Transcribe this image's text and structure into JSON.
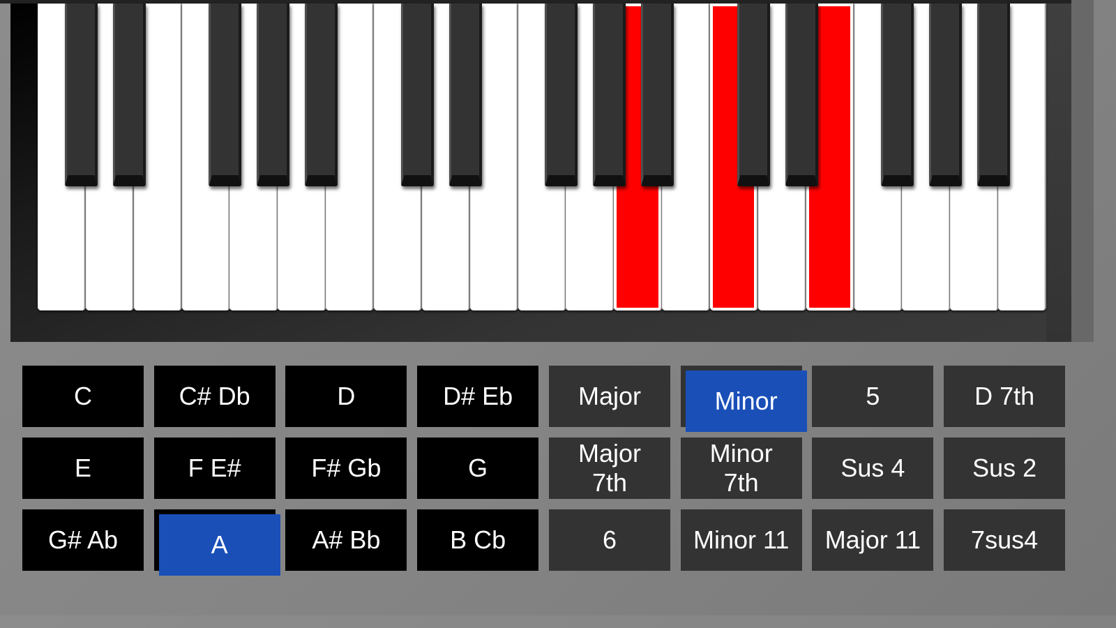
{
  "keyboard": {
    "white_keys": [
      "C",
      "D",
      "E",
      "F",
      "G",
      "A",
      "B",
      "C",
      "D",
      "E",
      "F",
      "G",
      "A",
      "B",
      "C",
      "D",
      "E",
      "F",
      "G",
      "A",
      "B"
    ],
    "black_keys": [
      "C#",
      "D#",
      "F#",
      "G#",
      "A#",
      "C#",
      "D#",
      "F#",
      "G#",
      "A#",
      "C#",
      "D#",
      "F#",
      "G#",
      "A#"
    ],
    "highlighted_white_key_indices": [
      12,
      14,
      16
    ],
    "highlight_color": "#ff0000"
  },
  "root_notes": {
    "items": [
      {
        "label": "C",
        "selected": false
      },
      {
        "label": "C# Db",
        "selected": false
      },
      {
        "label": "D",
        "selected": false
      },
      {
        "label": "D# Eb",
        "selected": false
      },
      {
        "label": "E",
        "selected": false
      },
      {
        "label": "F E#",
        "selected": false
      },
      {
        "label": "F# Gb",
        "selected": false
      },
      {
        "label": "G",
        "selected": false
      },
      {
        "label": "G# Ab",
        "selected": false
      },
      {
        "label": "A",
        "selected": true
      },
      {
        "label": "A# Bb",
        "selected": false
      },
      {
        "label": "B Cb",
        "selected": false
      }
    ]
  },
  "chord_types": {
    "items": [
      {
        "label": "Major",
        "selected": false
      },
      {
        "label": "Minor",
        "selected": true
      },
      {
        "label": "5",
        "selected": false
      },
      {
        "label": "D 7th",
        "selected": false
      },
      {
        "label": "Major\n7th",
        "selected": false
      },
      {
        "label": "Minor\n7th",
        "selected": false
      },
      {
        "label": "Sus 4",
        "selected": false
      },
      {
        "label": "Sus 2",
        "selected": false
      },
      {
        "label": "6",
        "selected": false
      },
      {
        "label": "Minor 11",
        "selected": false
      },
      {
        "label": "Major 11",
        "selected": false
      },
      {
        "label": "7sus4",
        "selected": false
      }
    ]
  },
  "colors": {
    "selected_button": "#1a4fb8",
    "note_button": "#000000",
    "chord_button": "#333333"
  }
}
